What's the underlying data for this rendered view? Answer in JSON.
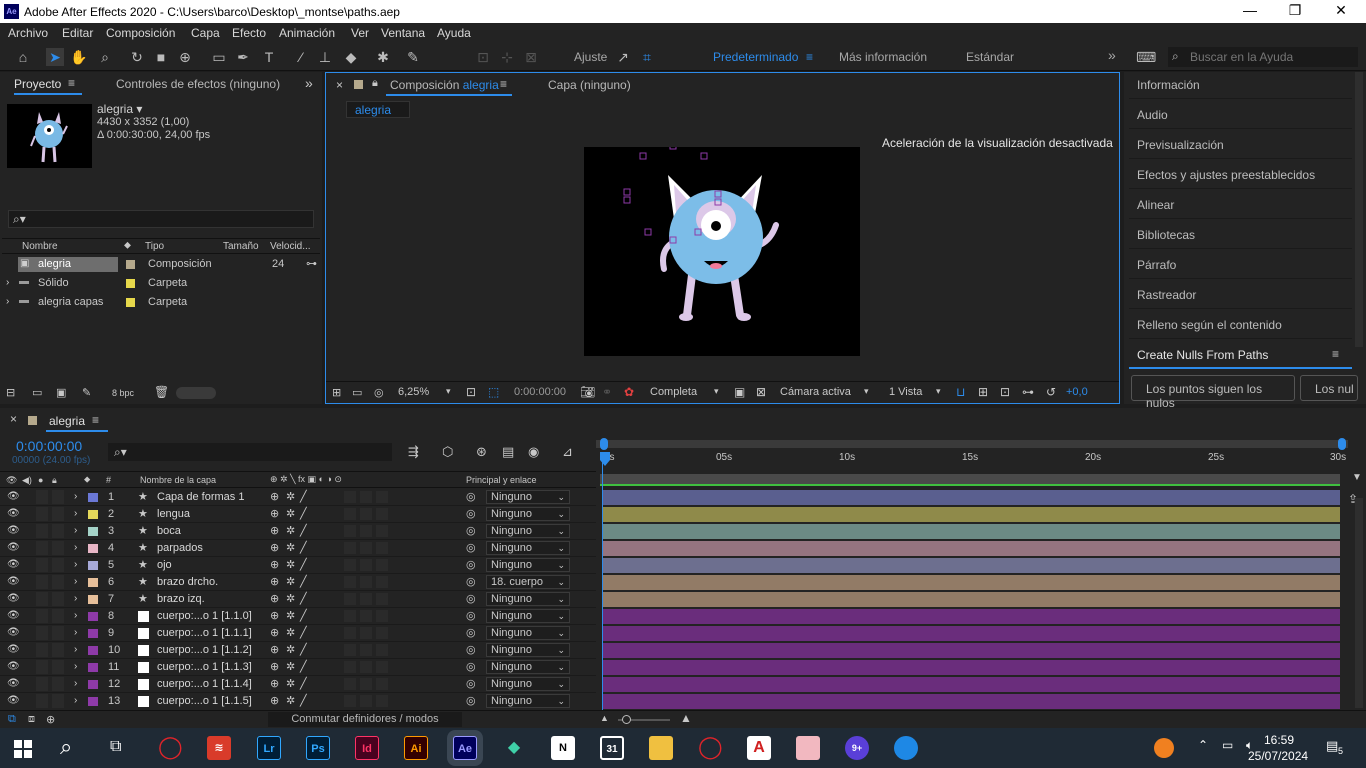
{
  "window": {
    "logo": "Ae",
    "title": "Adobe After Effects 2020 - C:\\Users\\barco\\Desktop\\_montse\\paths.aep",
    "minimize": "—",
    "maximize": "❐",
    "close": "✕"
  },
  "menu": [
    "Archivo",
    "Editar",
    "Composición",
    "Capa",
    "Efecto",
    "Animación",
    "Ver",
    "Ventana",
    "Ayuda"
  ],
  "toolbar": {
    "snap_label": "Ajuste",
    "workspaces": [
      "Predeterminado",
      "Más información",
      "Estándar"
    ],
    "more": "»",
    "search_placeholder": "Buscar en la Ayuda"
  },
  "project": {
    "tab_project": "Proyecto",
    "tab_effects": "Controles de efectos (ninguno)",
    "item_name": "alegria ▾",
    "item_dims": "4430 x 3352 (1,00)",
    "item_duration": "Δ 0:00:30:00, 24,00 fps",
    "columns": [
      "Nombre",
      "Tipo",
      "Tamaño",
      "Velocid..."
    ],
    "rows": [
      {
        "name": "alegria",
        "type": "Composición",
        "fps": "24",
        "color": "#b5a98c"
      },
      {
        "name": "Sólido",
        "type": "Carpeta",
        "fps": "",
        "color": "#e6d84b"
      },
      {
        "name": "alegria capas",
        "type": "Carpeta",
        "fps": "",
        "color": "#e6d84b"
      }
    ],
    "bpc": "8 bpc"
  },
  "composition": {
    "close": "×",
    "tab_label": "Composición",
    "tab_name": "alegria",
    "layer_tab": "Capa (ninguno)",
    "breadcrumb": "alegria",
    "notice": "Aceleración de la visualización desactivada",
    "zoom": "6,25%",
    "timecode": "0:00:00:00",
    "resolution": "Completa",
    "camera": "Cámara activa",
    "views": "1 Vista",
    "exposure": "+0,0"
  },
  "right_panel": {
    "items": [
      "Información",
      "Audio",
      "Previsualización",
      "Efectos y ajustes preestablecidos",
      "Alinear",
      "Bibliotecas",
      "Párrafo",
      "Rastreador",
      "Relleno según el contenido"
    ],
    "nulls_title": "Create Nulls From Paths",
    "buttons": [
      "Los puntos siguen los nulos",
      "Los nul"
    ]
  },
  "timeline": {
    "tab": "alegria",
    "timecode": "0:00:00:00",
    "frames": "00000 (24.00 fps)",
    "col_layer": "Nombre de la capa",
    "col_parent": "Principal y enlace",
    "ruler": [
      "0s",
      "05s",
      "10s",
      "15s",
      "20s",
      "25s",
      "30s"
    ],
    "toggle_label": "Conmutar definidores / modos",
    "layers": [
      {
        "num": "1",
        "name": "Capa de formas 1",
        "star": true,
        "parent": "Ninguno",
        "label": "#6b78d6",
        "bar": "#5a5f8f"
      },
      {
        "num": "2",
        "name": "lengua",
        "star": true,
        "parent": "Ninguno",
        "label": "#e4d85a",
        "bar": "#8f8a4a"
      },
      {
        "num": "3",
        "name": "boca",
        "star": true,
        "parent": "Ninguno",
        "label": "#a5d3c8",
        "bar": "#6c8a85"
      },
      {
        "num": "4",
        "name": "parpados",
        "star": true,
        "parent": "Ninguno",
        "label": "#e8b6c6",
        "bar": "#957480"
      },
      {
        "num": "5",
        "name": "ojo",
        "star": true,
        "parent": "Ninguno",
        "label": "#a7a9d8",
        "bar": "#6d6f8f"
      },
      {
        "num": "6",
        "name": "brazo drcho.",
        "star": true,
        "parent": "18. cuerpo",
        "label": "#e6bf9a",
        "bar": "#927b66"
      },
      {
        "num": "7",
        "name": "brazo izq.",
        "star": true,
        "parent": "Ninguno",
        "label": "#e6bf9a",
        "bar": "#927b66"
      },
      {
        "num": "8",
        "name": "cuerpo:...o 1 [1.1.0]",
        "star": false,
        "parent": "Ninguno",
        "label": "#8e3aa8",
        "bar": "#6a2d7c"
      },
      {
        "num": "9",
        "name": "cuerpo:...o 1 [1.1.1]",
        "star": false,
        "parent": "Ninguno",
        "label": "#8e3aa8",
        "bar": "#6a2d7c"
      },
      {
        "num": "10",
        "name": "cuerpo:...o 1 [1.1.2]",
        "star": false,
        "parent": "Ninguno",
        "label": "#8e3aa8",
        "bar": "#6a2d7c"
      },
      {
        "num": "11",
        "name": "cuerpo:...o 1 [1.1.3]",
        "star": false,
        "parent": "Ninguno",
        "label": "#8e3aa8",
        "bar": "#6a2d7c"
      },
      {
        "num": "12",
        "name": "cuerpo:...o 1 [1.1.4]",
        "star": false,
        "parent": "Ninguno",
        "label": "#8e3aa8",
        "bar": "#6a2d7c"
      },
      {
        "num": "13",
        "name": "cuerpo:...o 1 [1.1.5]",
        "star": false,
        "parent": "Ninguno",
        "label": "#8e3aa8",
        "bar": "#6a2d7c"
      }
    ]
  },
  "taskbar": {
    "time": "16:59",
    "date": "25/07/2024",
    "notif_count": "5",
    "apps": [
      {
        "label": "Lr",
        "bg": "#001e36",
        "fg": "#31a8ff"
      },
      {
        "label": "Ps",
        "bg": "#001e36",
        "fg": "#31a8ff"
      },
      {
        "label": "Id",
        "bg": "#49021f",
        "fg": "#ff3366"
      },
      {
        "label": "Ai",
        "bg": "#330000",
        "fg": "#ff9a00"
      },
      {
        "label": "Ae",
        "bg": "#00005b",
        "fg": "#9999ff"
      }
    ]
  },
  "colors": {
    "accent": "#2d8ceb",
    "panel": "#232323",
    "background": "#1d1d1d"
  }
}
